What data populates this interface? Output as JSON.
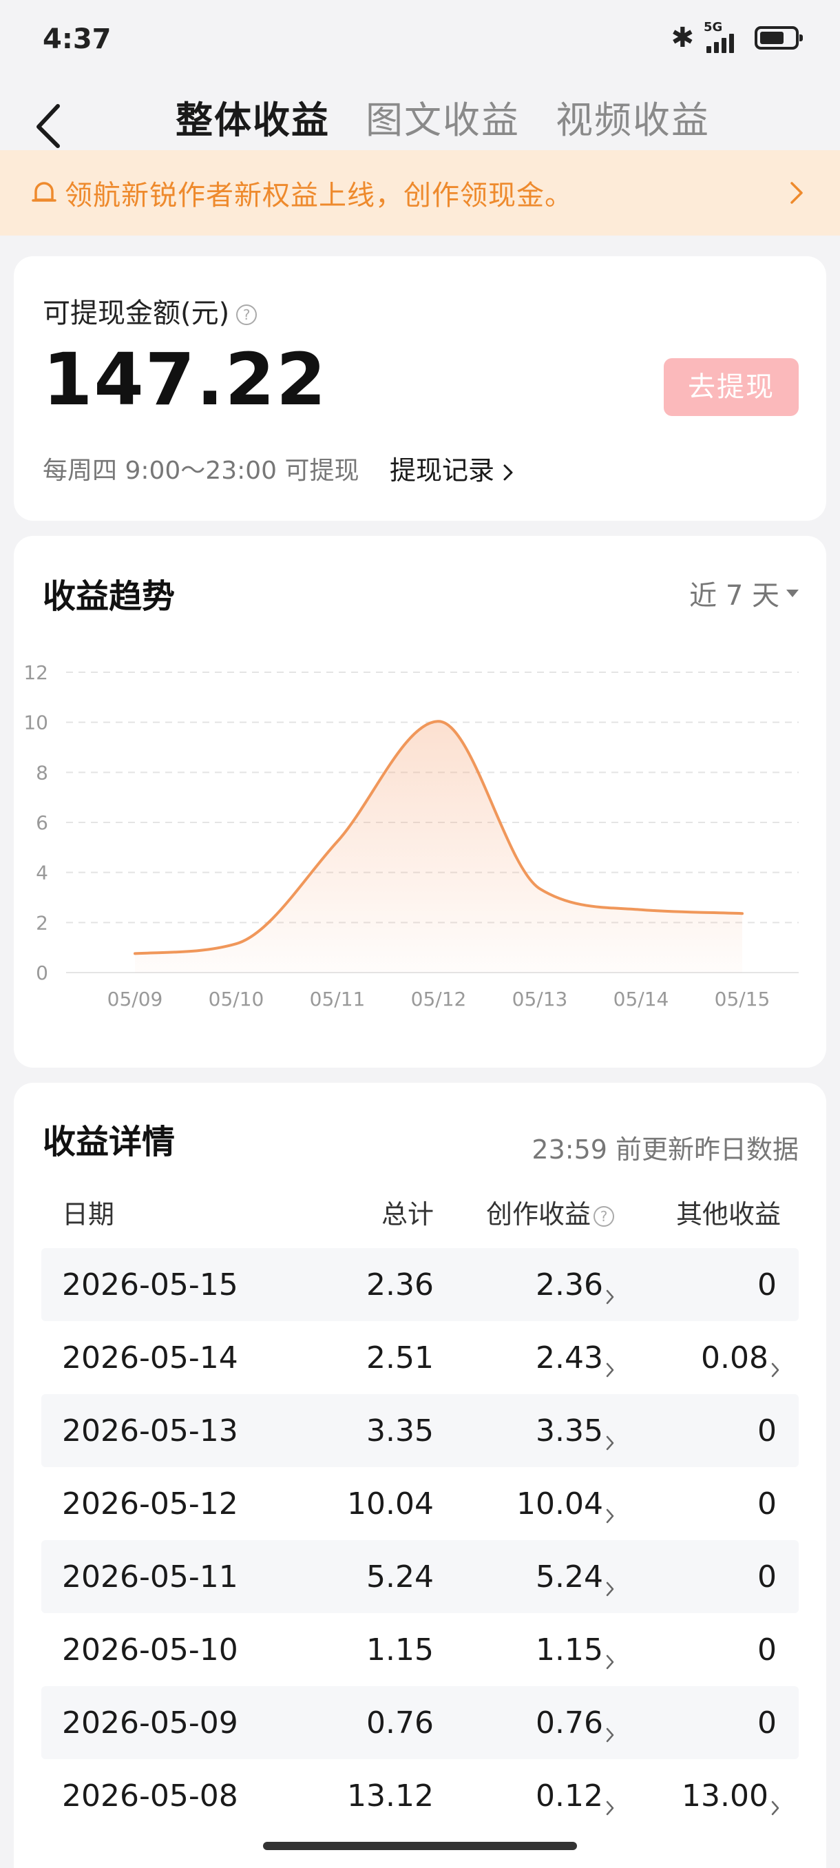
{
  "status_bar": {
    "time": "4:37",
    "network": "5G"
  },
  "nav": {
    "tabs": [
      {
        "label": "整体收益",
        "active": true
      },
      {
        "label": "图文收益",
        "active": false
      },
      {
        "label": "视频收益",
        "active": false
      }
    ]
  },
  "notice": {
    "text": "领航新锐作者新权益上线，创作领现金。"
  },
  "balance": {
    "label": "可提现金额(元)",
    "amount": "147.22",
    "withdraw_button": "去提现",
    "withdraw_info": "每周四 9:00～23:00 可提现",
    "record_link": "提现记录"
  },
  "trend": {
    "title": "收益趋势",
    "range": "近 7 天",
    "line_color": "#f0975a"
  },
  "chart_data": {
    "type": "line",
    "categories": [
      "05/09",
      "05/10",
      "05/11",
      "05/12",
      "05/13",
      "05/14",
      "05/15"
    ],
    "values": [
      0.76,
      1.15,
      5.24,
      10.04,
      3.35,
      2.51,
      2.36
    ],
    "y_ticks": [
      0,
      2,
      4,
      6,
      8,
      10,
      12
    ],
    "ylim": [
      0,
      12
    ],
    "grid": true,
    "smooth": true,
    "area_fill": true
  },
  "detail": {
    "title": "收益详情",
    "note": "23:59 前更新昨日数据",
    "headers": {
      "date": "日期",
      "total": "总计",
      "create": "创作收益",
      "other": "其他收益"
    },
    "rows": [
      {
        "date": "2026-05-15",
        "total": "2.36",
        "create": "2.36",
        "other": "0"
      },
      {
        "date": "2026-05-14",
        "total": "2.51",
        "create": "2.43",
        "other": "0.08"
      },
      {
        "date": "2026-05-13",
        "total": "3.35",
        "create": "3.35",
        "other": "0"
      },
      {
        "date": "2026-05-12",
        "total": "10.04",
        "create": "10.04",
        "other": "0"
      },
      {
        "date": "2026-05-11",
        "total": "5.24",
        "create": "5.24",
        "other": "0"
      },
      {
        "date": "2026-05-10",
        "total": "1.15",
        "create": "1.15",
        "other": "0"
      },
      {
        "date": "2026-05-09",
        "total": "0.76",
        "create": "0.76",
        "other": "0"
      },
      {
        "date": "2026-05-08",
        "total": "13.12",
        "create": "0.12",
        "other": "13.00"
      }
    ]
  }
}
